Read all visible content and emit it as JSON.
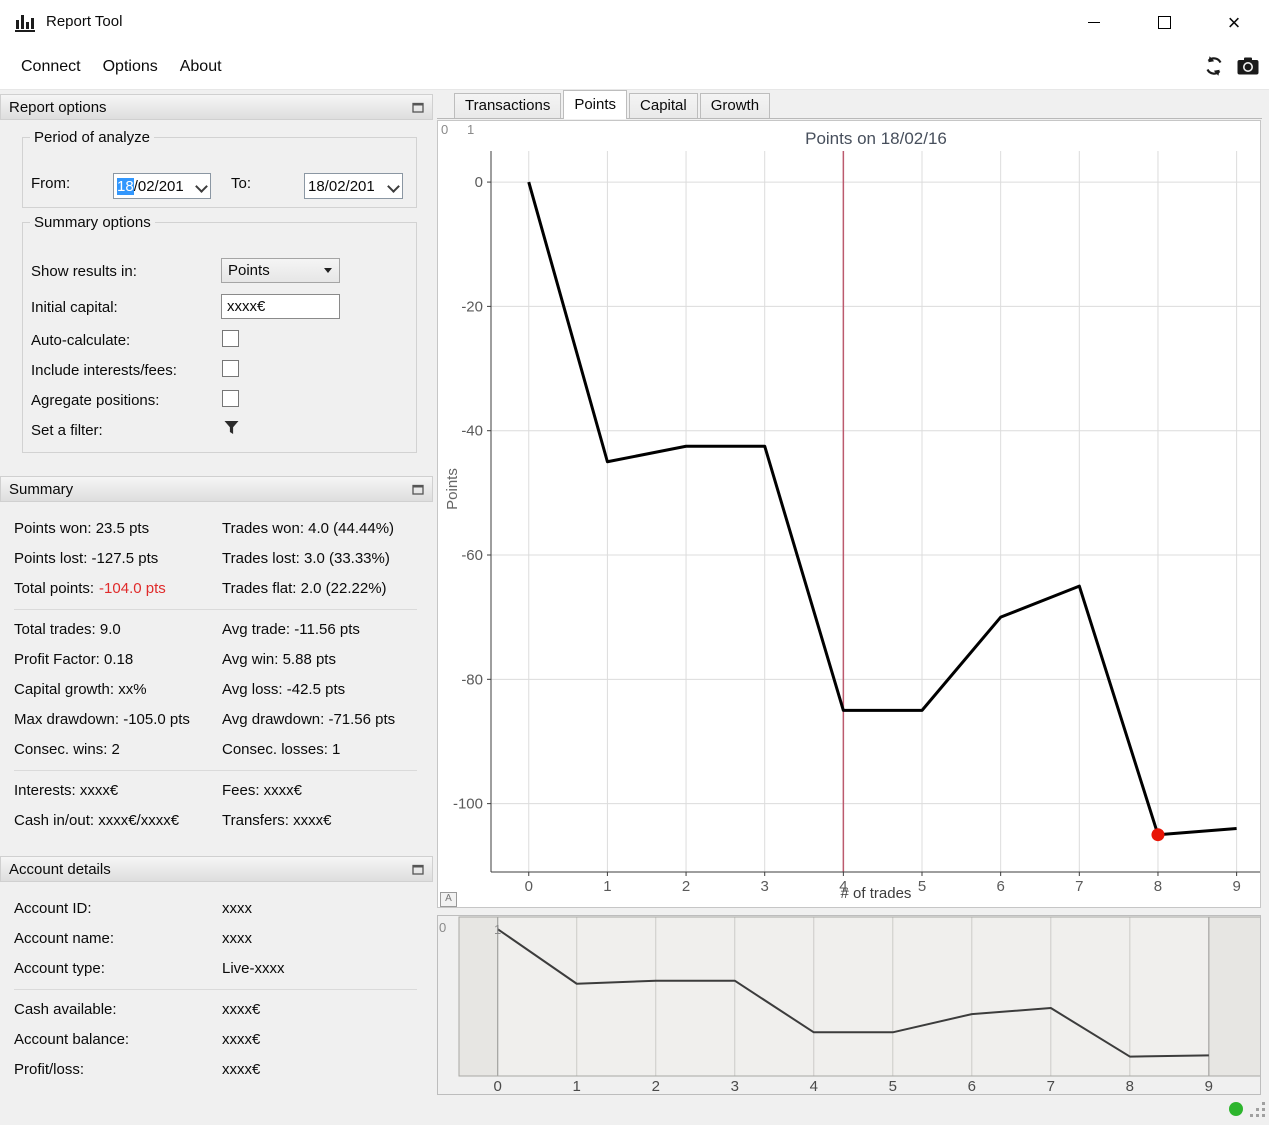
{
  "window": {
    "title": "Report Tool",
    "close_glyph": "×"
  },
  "menu": {
    "connect": "Connect",
    "options": "Options",
    "about": "About"
  },
  "report_options": {
    "header": "Report options",
    "period_group": {
      "title": "Period of analyze",
      "from_label": "From:",
      "from_value_selected": "18",
      "from_value_rest": "/02/201",
      "to_label": "To:",
      "to_value": "18/02/201"
    },
    "summary_group": {
      "title": "Summary options",
      "show_results_label": "Show results in:",
      "show_results_value": "Points",
      "initial_capital_label": "Initial capital:",
      "initial_capital_value": "xxxx€",
      "auto_calculate_label": "Auto-calculate:",
      "include_fees_label": "Include interests/fees:",
      "agregate_label": "Agregate positions:",
      "filter_label": "Set a filter:"
    }
  },
  "summary": {
    "header": "Summary",
    "total_points_color": "#e02b2b",
    "block1": [
      {
        "left": "Points won: 23.5 pts",
        "right": "Trades won: 4.0 (44.44%)"
      },
      {
        "left": "Points lost: -127.5 pts",
        "right": "Trades lost: 3.0 (33.33%)"
      },
      {
        "left_label": "Total points:",
        "left_value": "-104.0 pts",
        "right": "Trades flat: 2.0 (22.22%)"
      }
    ],
    "block2": [
      {
        "left": "Total trades: 9.0",
        "right": "Avg trade: -11.56 pts"
      },
      {
        "left": "Profit Factor: 0.18",
        "right": "Avg win: 5.88 pts"
      },
      {
        "left": "Capital growth: xx%",
        "right": "Avg loss: -42.5 pts"
      },
      {
        "left": "Max drawdown: -105.0 pts",
        "right": "Avg drawdown: -71.56 pts"
      },
      {
        "left": "Consec. wins: 2",
        "right": "Consec. losses: 1"
      }
    ],
    "block3": [
      {
        "left": "Interests: xxxx€",
        "right": "Fees: xxxx€"
      },
      {
        "left": "Cash in/out: xxxx€/xxxx€",
        "right": "Transfers: xxxx€"
      }
    ]
  },
  "account": {
    "header": "Account details",
    "rows1": [
      {
        "label": "Account ID:",
        "value": "xxxx"
      },
      {
        "label": "Account name:",
        "value": "xxxx"
      },
      {
        "label": "Account type:",
        "value": "Live-xxxx"
      }
    ],
    "rows2": [
      {
        "label": "Cash available:",
        "value": "xxxx€"
      },
      {
        "label": "Account balance:",
        "value": "xxxx€"
      },
      {
        "label": "Profit/loss:",
        "value": "xxxx€"
      }
    ]
  },
  "tabs": [
    {
      "label": "Transactions",
      "active": false
    },
    {
      "label": "Points",
      "active": true
    },
    {
      "label": "Capital",
      "active": false
    },
    {
      "label": "Growth",
      "active": false
    }
  ],
  "chart_data": {
    "type": "line",
    "title": "Points on 18/02/16",
    "xlabel": "# of trades",
    "ylabel": "Points",
    "x": [
      0,
      1,
      2,
      3,
      4,
      5,
      6,
      7,
      8,
      9
    ],
    "values": [
      0,
      -45,
      -42.5,
      -42.5,
      -85,
      -85,
      -70,
      -65,
      -105,
      -104
    ],
    "x_ticks": [
      "0",
      "1",
      "2",
      "3",
      "4",
      "5",
      "6",
      "7",
      "8",
      "9"
    ],
    "y_ticks": [
      "0",
      "-20",
      "-40",
      "-60",
      "-80",
      "-100"
    ],
    "xlim": [
      -0.48,
      9.31
    ],
    "ylim": [
      -111,
      5
    ],
    "grid": true,
    "line_color": "#000000",
    "line_width": 3,
    "crosshair": {
      "x": 4,
      "color": "#bc5a6e"
    },
    "last_point_marker": {
      "index": 8,
      "color": "#e81506"
    },
    "corner_labels": [
      "0",
      "1"
    ],
    "auto_range_label": "A",
    "navigator": {
      "xlim": [
        -0.49,
        9.66
      ],
      "ylim": [
        -121,
        10
      ],
      "x_ticks": [
        "0",
        "1",
        "2",
        "3",
        "4",
        "5",
        "6",
        "7",
        "8",
        "9"
      ],
      "line_color": "#3c3c3c",
      "line_width": 2,
      "bg": "#e7e6e3",
      "corner_labels": [
        "0",
        "1"
      ]
    }
  },
  "status": {
    "connection_color": "#2db52d"
  }
}
